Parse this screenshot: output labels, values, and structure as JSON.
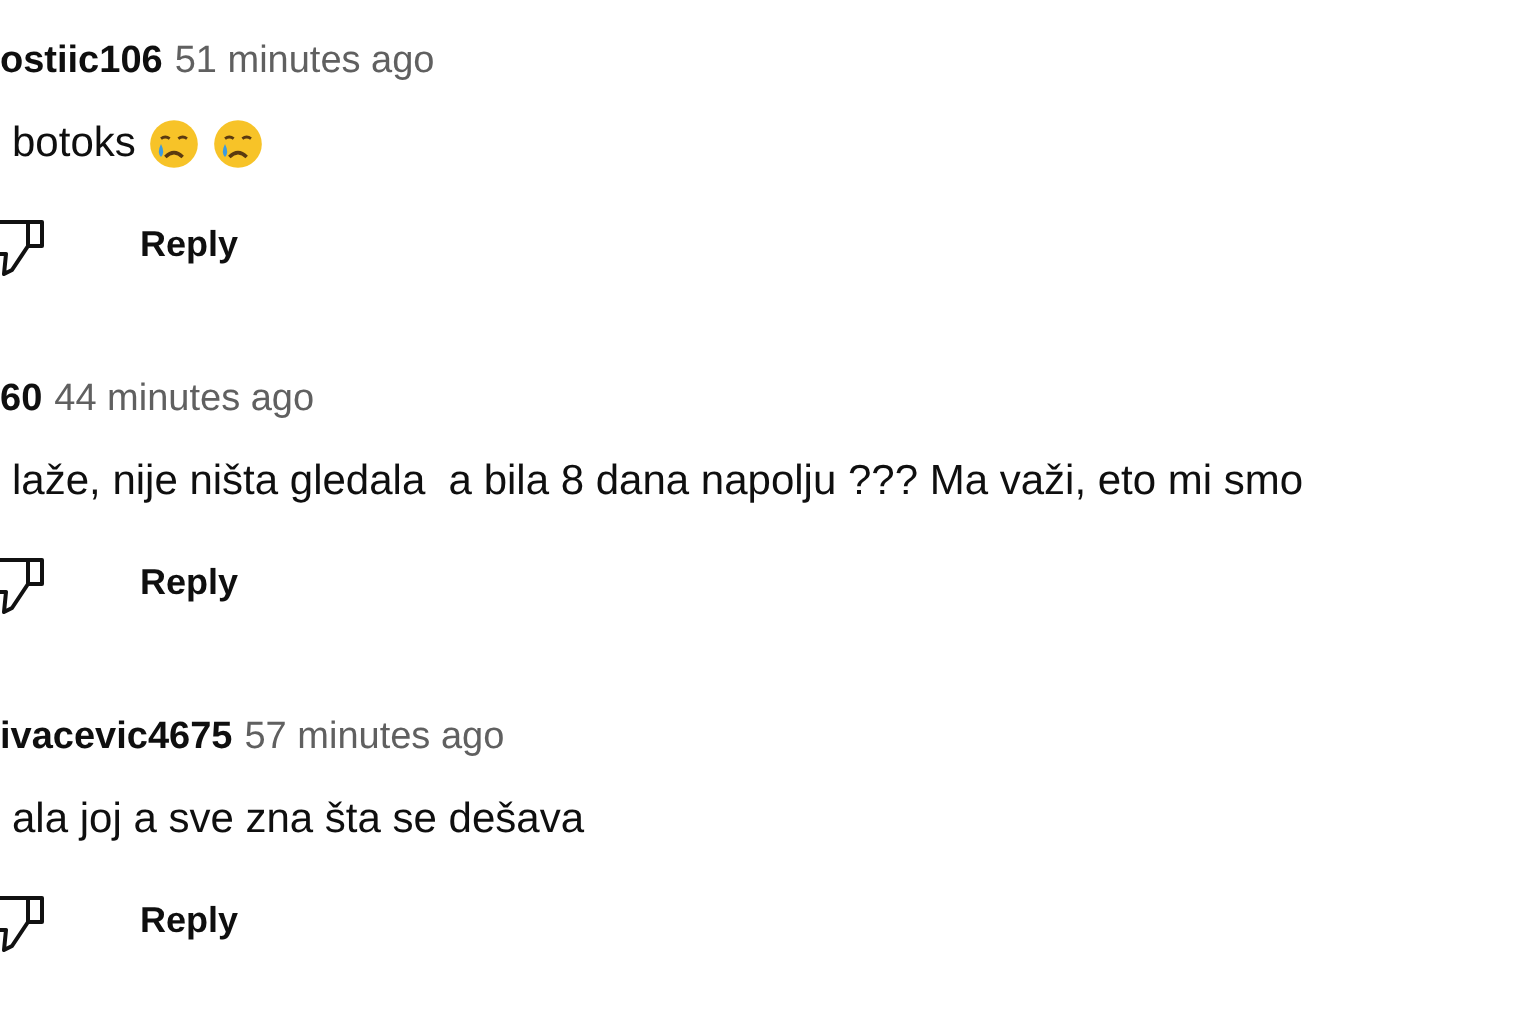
{
  "comments": [
    {
      "author": "ostiic106",
      "time": "51 minutes ago",
      "text": "botoks",
      "emojis": [
        {
          "kind": "crying-face"
        },
        {
          "kind": "crying-face"
        }
      ],
      "reply": "Reply"
    },
    {
      "author": "60",
      "time": "44 minutes ago",
      "text": "laže, nije ništa gledala  a bila 8 dana napolju ??? Ma važi, eto mi smo",
      "reply": "Reply"
    },
    {
      "author": "ivacevic4675",
      "time": "57 minutes ago",
      "text": "ala joj a sve zna šta se dešava",
      "reply": "Reply"
    }
  ]
}
